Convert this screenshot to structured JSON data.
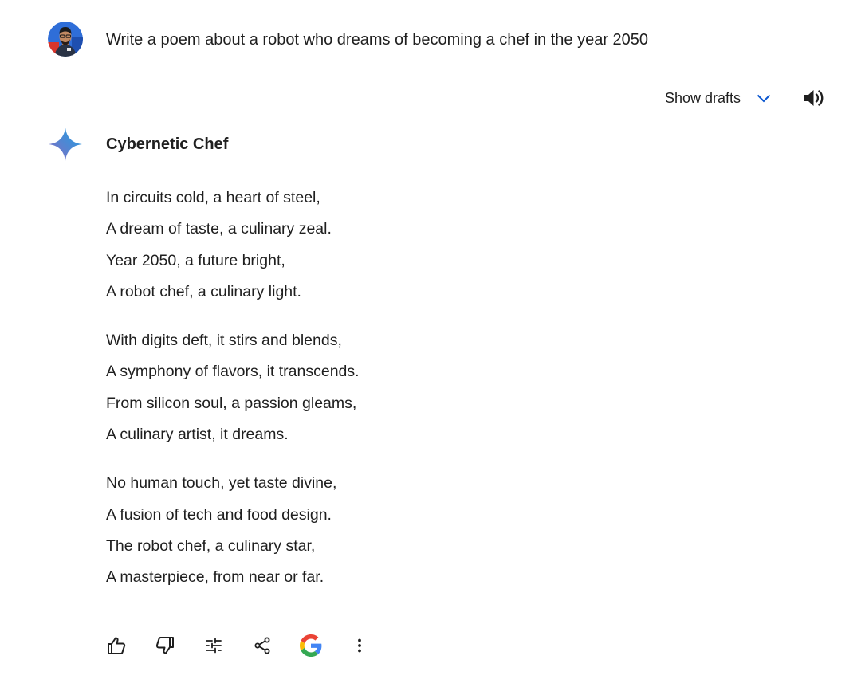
{
  "prompt": {
    "text": "Write a poem about a robot who dreams of becoming a chef in the year 2050",
    "avatar_icon": "user-avatar"
  },
  "response_header": {
    "show_drafts_label": "Show drafts",
    "chevron_icon": "chevron-down-icon",
    "speaker_icon": "speaker-icon"
  },
  "response": {
    "assistant_icon": "gemini-sparkle-icon",
    "title": "Cybernetic Chef",
    "stanzas": [
      {
        "lines": [
          "In circuits cold, a heart of steel,",
          "A dream of taste, a culinary zeal.",
          "Year 2050, a future bright,",
          "A robot chef, a culinary light."
        ]
      },
      {
        "lines": [
          "With digits deft, it stirs and blends,",
          "A symphony of flavors, it transcends.",
          "From silicon soul, a passion gleams,",
          "A culinary artist, it dreams."
        ]
      },
      {
        "lines": [
          "No human touch, yet taste divine,",
          "A fusion of tech and food design.",
          "The robot chef, a culinary star,",
          "A masterpiece, from near or far."
        ]
      }
    ]
  },
  "actions": [
    "thumbs-up-icon",
    "thumbs-down-icon",
    "modify-response-icon",
    "share-icon",
    "google-search-icon",
    "more-options-icon"
  ],
  "colors": {
    "text": "#1f1f1f",
    "accent_blue": "#0b57d0",
    "icon_gray": "#444746"
  }
}
